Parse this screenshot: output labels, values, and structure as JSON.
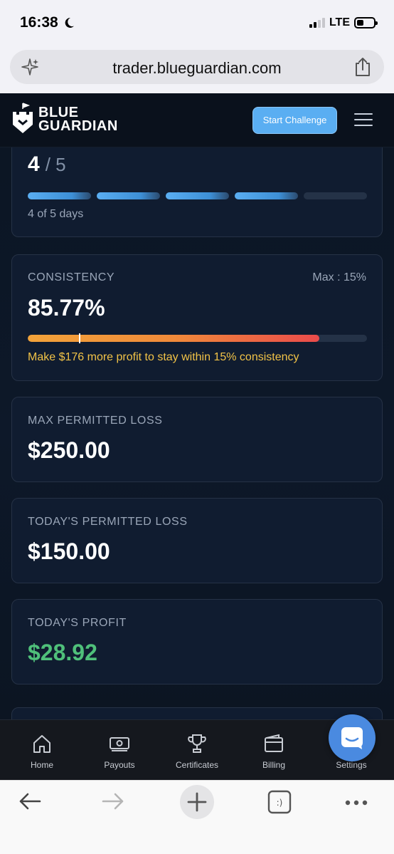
{
  "status_bar": {
    "time": "16:38",
    "network": "LTE"
  },
  "browser": {
    "url": "trader.blueguardian.com"
  },
  "header": {
    "logo_line1": "BLUE",
    "logo_line2": "GUARDIAN",
    "start_button": "Start Challenge"
  },
  "trading_days": {
    "current": "4",
    "separator": "/",
    "total": "5",
    "progress_text": "4 of 5 days",
    "segments": [
      true,
      true,
      true,
      true,
      false
    ]
  },
  "consistency": {
    "label": "CONSISTENCY",
    "max_label": "Max : 15%",
    "value": "85.77%",
    "bar_fill_fraction": 0.86,
    "marker_fraction": 0.15,
    "message": "Make $176 more profit to stay within 15% consistency"
  },
  "max_loss": {
    "label": "MAX PERMITTED LOSS",
    "value": "$250.00"
  },
  "todays_loss": {
    "label": "TODAY'S PERMITTED LOSS",
    "value": "$150.00"
  },
  "todays_profit": {
    "label": "TODAY'S PROFIT",
    "value": "$28.92",
    "color": "#4fc07a"
  },
  "nav": {
    "items": [
      {
        "label": "Home",
        "icon": "home-icon"
      },
      {
        "label": "Payouts",
        "icon": "money-icon"
      },
      {
        "label": "Certificates",
        "icon": "trophy-icon"
      },
      {
        "label": "Billing",
        "icon": "wallet-icon"
      },
      {
        "label": "Settings",
        "icon": "gear-icon"
      }
    ]
  },
  "colors": {
    "accent": "#5aaef2",
    "background": "#0b1422",
    "warning": "#f2c347",
    "profit": "#4fc07a"
  }
}
